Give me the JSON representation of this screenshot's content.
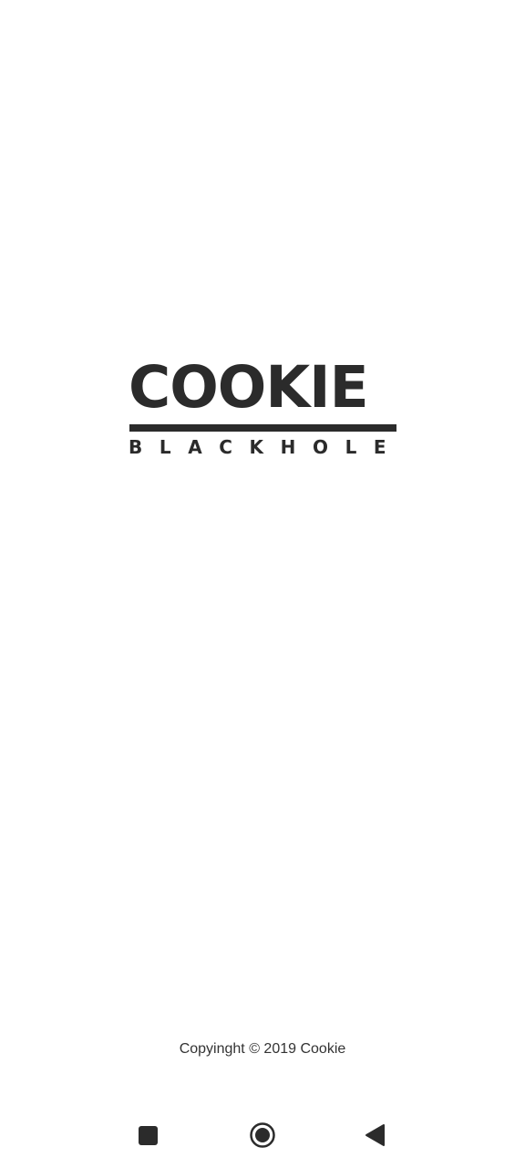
{
  "splash": {
    "brand_name": "COOKIE",
    "brand_subtitle": "BLACKHOLE",
    "copyright": "Copyinght © 2019 Cookie"
  },
  "nav": {
    "recents_icon": "square-icon",
    "home_icon": "circle-home-icon",
    "back_icon": "triangle-back-icon"
  },
  "colors": {
    "background": "#ffffff",
    "logo": "#2b2b2b",
    "text": "#333333"
  }
}
